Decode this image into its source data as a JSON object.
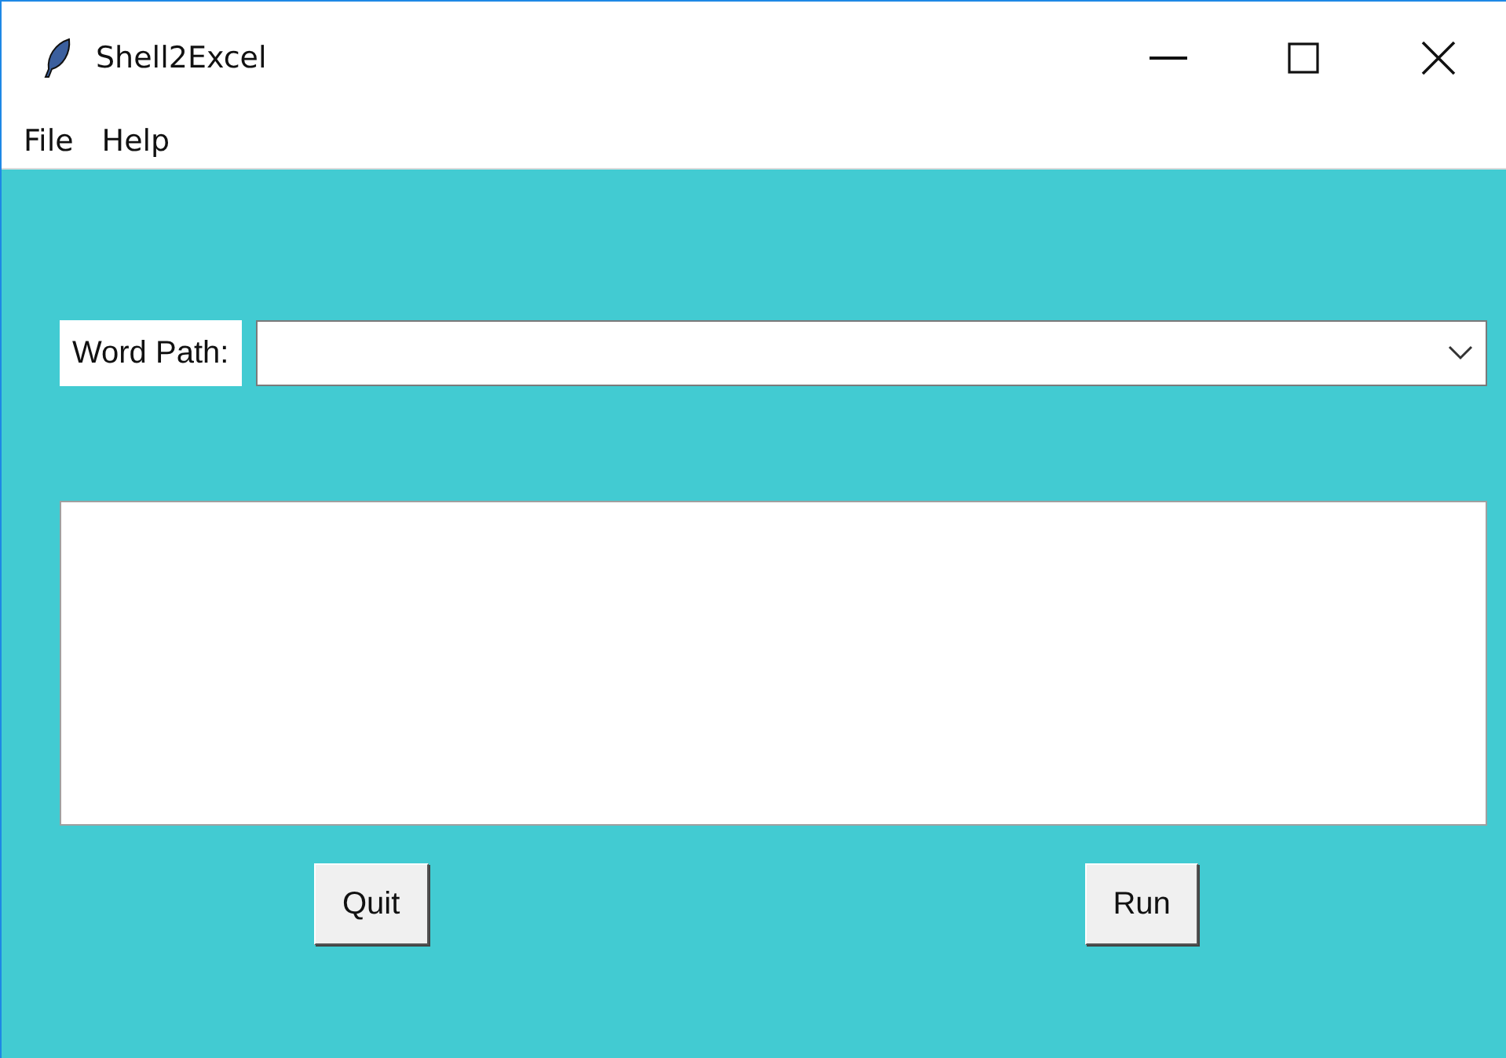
{
  "window": {
    "title": "Shell2Excel"
  },
  "menu": [
    "File",
    "Help"
  ],
  "word_path": {
    "label": "Word Path:"
  },
  "buttons": [
    "Quit",
    "Run"
  ]
}
